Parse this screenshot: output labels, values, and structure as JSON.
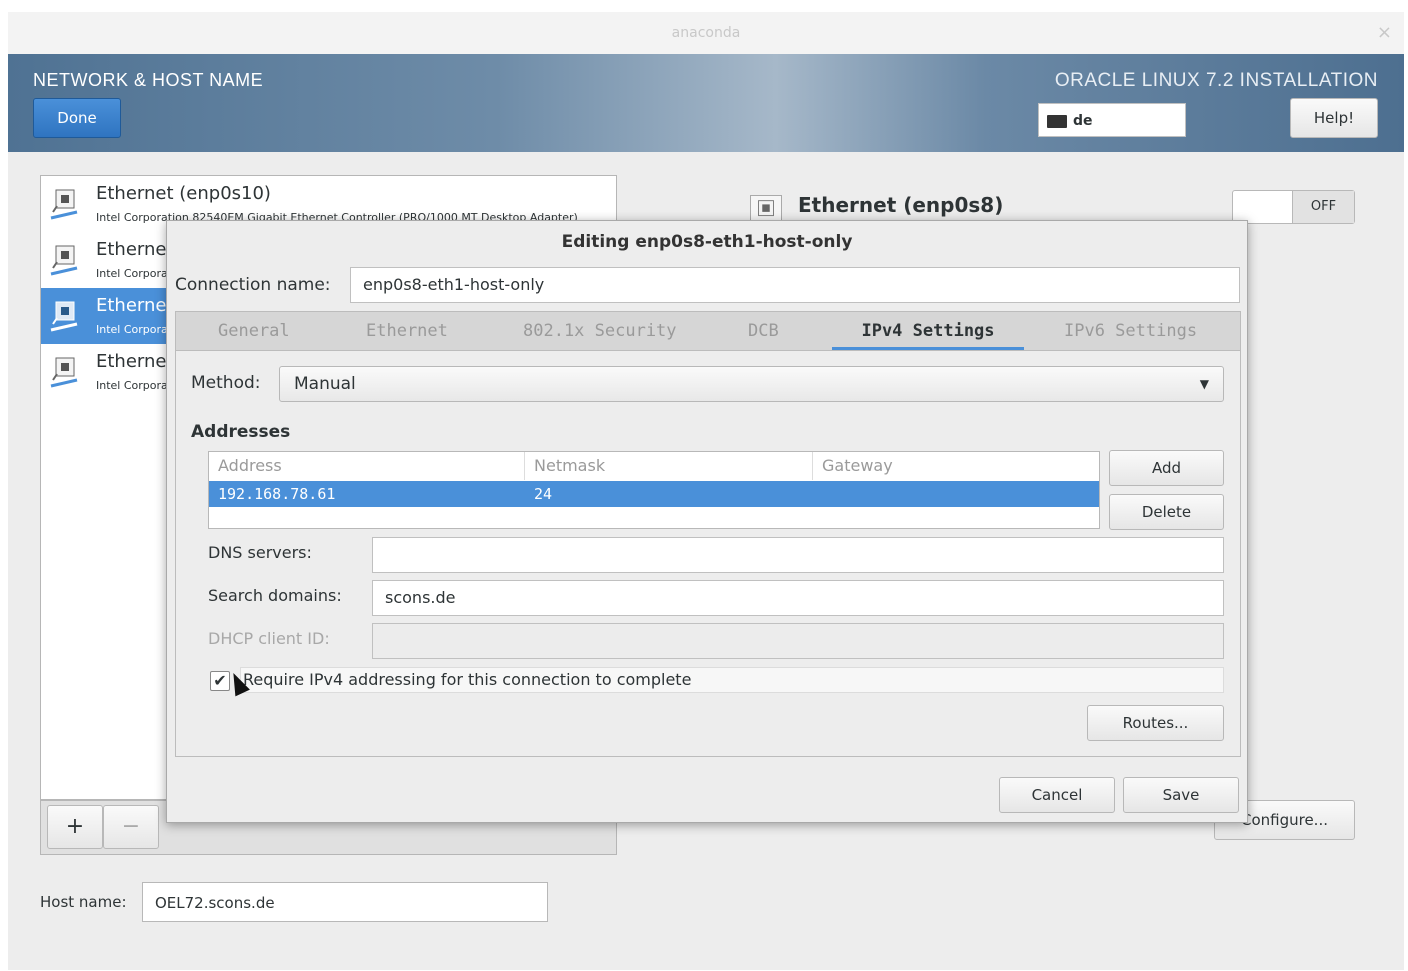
{
  "window": {
    "title": "anaconda",
    "close_glyph": "×"
  },
  "header": {
    "spoke_title": "NETWORK & HOST NAME",
    "product_title": "ORACLE LINUX 7.2 INSTALLATION",
    "done_label": "Done",
    "help_label": "Help!",
    "keyboard_layout": "de"
  },
  "devices": [
    {
      "name": "Ethernet (enp0s10)",
      "description": "Intel Corporation 82540EM Gigabit Ethernet Controller (PRO/1000 MT Desktop Adapter)",
      "icon": "network-wired-icon",
      "selected": false
    },
    {
      "name": "Ethernet",
      "description": "Intel Corporation",
      "icon": "network-wired-icon",
      "selected": false
    },
    {
      "name": "Ethernet",
      "description": "Intel Corporation",
      "icon": "network-wired-icon",
      "selected": true
    },
    {
      "name": "Ethernet",
      "description": "Intel Corporation",
      "icon": "network-wired-icon",
      "selected": false
    }
  ],
  "list_tools": {
    "add": "+",
    "remove": "−"
  },
  "right_panel": {
    "device_name": "Ethernet (enp0s8)",
    "toggle_state": "OFF",
    "configure_label": "Configure..."
  },
  "hostname": {
    "label": "Host name:",
    "value": "OEL72.scons.de"
  },
  "dialog": {
    "title": "Editing enp0s8-eth1-host-only",
    "connection_name_label": "Connection name:",
    "connection_name_value": "enp0s8-eth1-host-only",
    "tabs": [
      "General",
      "Ethernet",
      "802.1x Security",
      "DCB",
      "IPv4 Settings",
      "IPv6 Settings"
    ],
    "active_tab": "IPv4 Settings",
    "method_label": "Method:",
    "method_value": "Manual",
    "addresses_heading": "Addresses",
    "address_columns": [
      "Address",
      "Netmask",
      "Gateway"
    ],
    "address_rows": [
      {
        "address": "192.168.78.61",
        "netmask": "24",
        "gateway": ""
      }
    ],
    "add_label": "Add",
    "delete_label": "Delete",
    "dns_label": "DNS servers:",
    "dns_value": "",
    "search_label": "Search domains:",
    "search_value": "scons.de",
    "dhcp_label": "DHCP client ID:",
    "dhcp_value": "",
    "require_ipv4_label": "Require IPv4 addressing for this connection to complete",
    "require_ipv4_checked": true,
    "routes_label": "Routes...",
    "cancel_label": "Cancel",
    "save_label": "Save"
  },
  "colors": {
    "accent": "#4a90d9",
    "header": "#5a7c9c"
  }
}
